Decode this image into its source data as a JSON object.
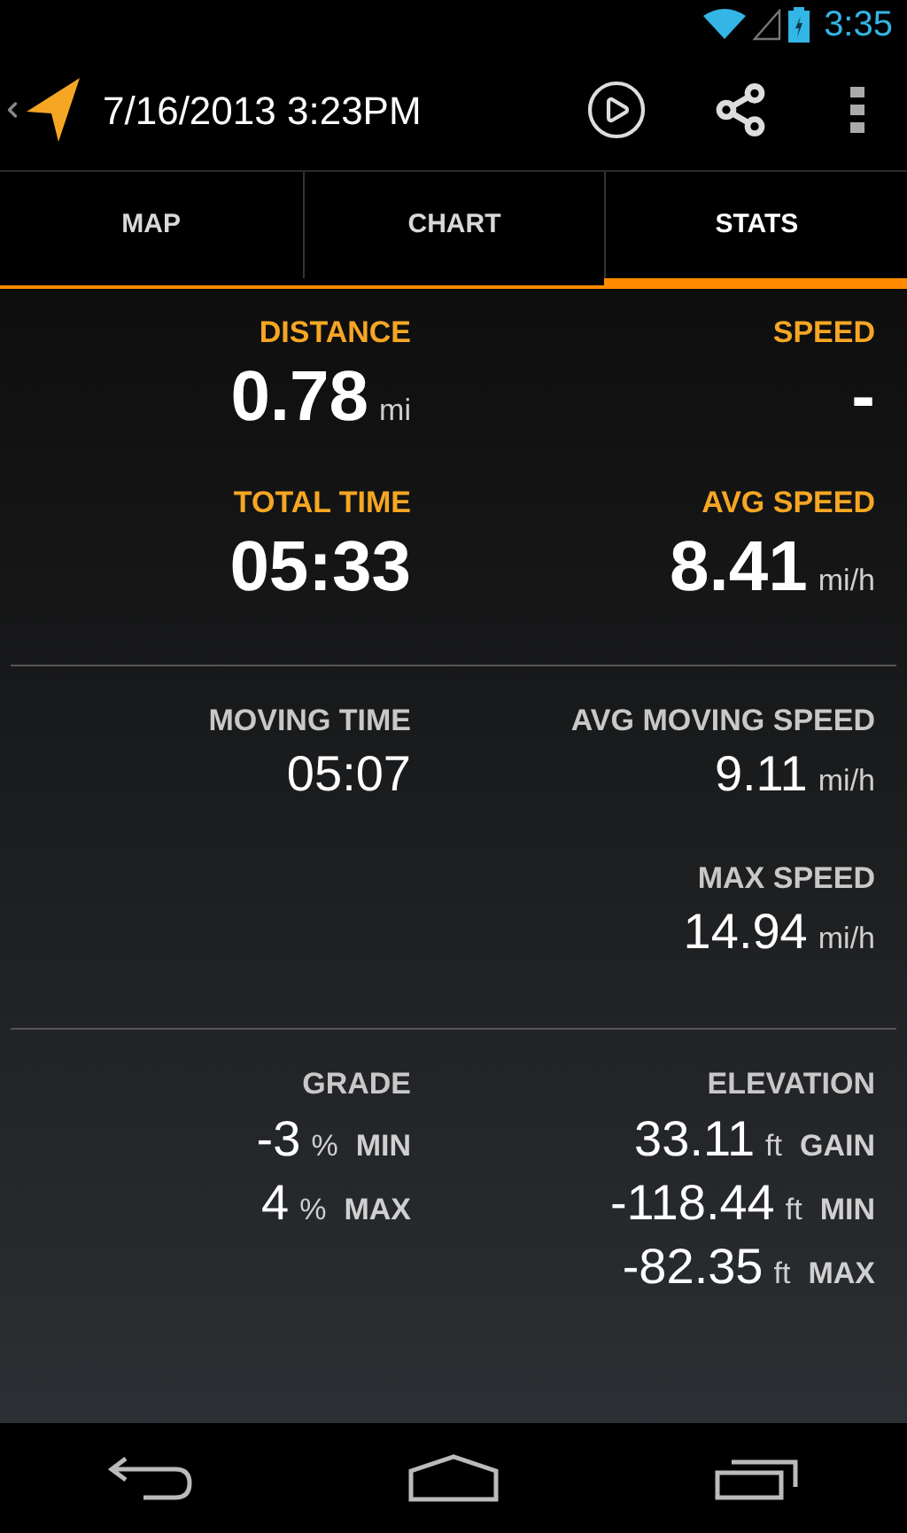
{
  "status_bar": {
    "time": "3:35"
  },
  "action_bar": {
    "title": "7/16/2013 3:23PM"
  },
  "tabs": [
    {
      "label": "MAP",
      "selected": false
    },
    {
      "label": "CHART",
      "selected": false
    },
    {
      "label": "STATS",
      "selected": true
    }
  ],
  "sections": [
    {
      "kind": "primary",
      "left": [
        {
          "label": "DISTANCE",
          "readings": [
            {
              "value": "0.78",
              "unit": "mi"
            }
          ]
        },
        {
          "label": "TOTAL TIME",
          "readings": [
            {
              "value": "05:33"
            }
          ]
        }
      ],
      "right": [
        {
          "label": "SPEED",
          "readings": [
            {
              "value": "-"
            }
          ]
        },
        {
          "label": "AVG SPEED",
          "readings": [
            {
              "value": "8.41",
              "unit": "mi/h"
            }
          ]
        }
      ]
    },
    {
      "kind": "secondary",
      "left": [
        {
          "label": "MOVING TIME",
          "readings": [
            {
              "value": "05:07"
            }
          ]
        }
      ],
      "right": [
        {
          "label": "AVG MOVING SPEED",
          "readings": [
            {
              "value": "9.11",
              "unit": "mi/h"
            }
          ]
        },
        {
          "label": "MAX SPEED",
          "readings": [
            {
              "value": "14.94",
              "unit": "mi/h"
            }
          ]
        }
      ]
    },
    {
      "kind": "range",
      "left": [
        {
          "label": "GRADE",
          "readings": [
            {
              "value": "-3",
              "unit": "%",
              "qualifier": "MIN"
            },
            {
              "value": "4",
              "unit": "%",
              "qualifier": "MAX"
            }
          ]
        }
      ],
      "right": [
        {
          "label": "ELEVATION",
          "readings": [
            {
              "value": "33.11",
              "unit": "ft",
              "qualifier": "GAIN"
            },
            {
              "value": "-118.44",
              "unit": "ft",
              "qualifier": "MIN"
            },
            {
              "value": "-82.35",
              "unit": "ft",
              "qualifier": "MAX"
            }
          ]
        }
      ]
    }
  ]
}
